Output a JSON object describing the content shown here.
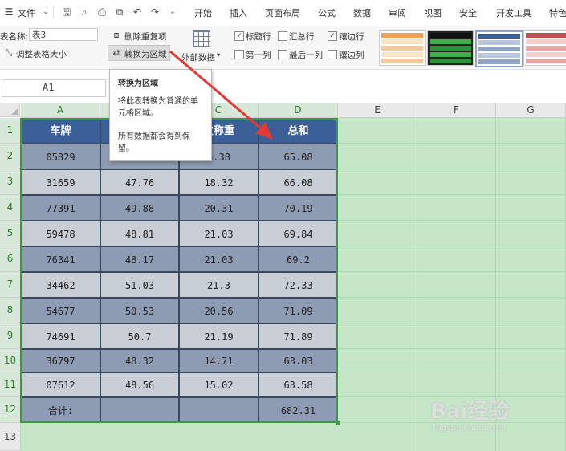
{
  "menubar": {
    "file_label": "文件",
    "tabs": [
      "开始",
      "插入",
      "页面布局",
      "公式",
      "数据",
      "审阅",
      "视图",
      "安全",
      "开发工具",
      "特色"
    ]
  },
  "ribbon": {
    "table_name_label": "表名称:",
    "table_name_value": "表3",
    "resize_table_label": "调整表格大小",
    "remove_duplicates_label": "删除重复项",
    "convert_to_range_label": "转换为区域",
    "external_data_label": "外部数据",
    "checkboxes": {
      "header_row": {
        "label": "标题行",
        "checked": true
      },
      "total_row": {
        "label": "汇总行",
        "checked": false
      },
      "banded_rows": {
        "label": "镶边行",
        "checked": true
      },
      "first_column": {
        "label": "第一列",
        "checked": false
      },
      "last_column": {
        "label": "最后一列",
        "checked": false
      },
      "banded_columns": {
        "label": "镶边列",
        "checked": false
      }
    }
  },
  "tooltip": {
    "title": "转换为区域",
    "line1": "将此表转换为普通的单",
    "line2": "元格区域。",
    "line3": "所有数据都会得到保",
    "line4": "留。"
  },
  "formulabar": {
    "cell_ref": "A1"
  },
  "grid": {
    "columns": [
      "A",
      "B",
      "C",
      "D",
      "E",
      "F",
      "G"
    ],
    "rows": [
      "1",
      "2",
      "3",
      "4",
      "5",
      "6",
      "7",
      "8",
      "9",
      "10",
      "11",
      "12",
      "13"
    ],
    "headers": [
      "车牌",
      "",
      "欠称重",
      "总和"
    ],
    "data": [
      [
        "05829",
        "",
        "6.38",
        "65.08"
      ],
      [
        "31659",
        "47.76",
        "18.32",
        "66.08"
      ],
      [
        "77391",
        "49.88",
        "20.31",
        "70.19"
      ],
      [
        "59478",
        "48.81",
        "21.03",
        "69.84"
      ],
      [
        "76341",
        "48.17",
        "21.03",
        "69.2"
      ],
      [
        "34462",
        "51.03",
        "21.3",
        "72.33"
      ],
      [
        "54677",
        "50.53",
        "20.56",
        "71.09"
      ],
      [
        "74691",
        "50.7",
        "21.19",
        "71.89"
      ],
      [
        "36797",
        "48.32",
        "14.71",
        "63.03"
      ],
      [
        "07612",
        "48.56",
        "15.02",
        "63.58"
      ]
    ],
    "total_label": "合计:",
    "total_value": "682.31"
  },
  "watermark": {
    "brand": "Bai经验",
    "url": "jingyan.baidu.com"
  },
  "colors": {
    "header_fill": "#3d5f98",
    "band_dark": "#8e9cb3",
    "band_light": "#c9ced6",
    "outside_fill": "#c6e6c8",
    "arrow": "#e53935"
  }
}
